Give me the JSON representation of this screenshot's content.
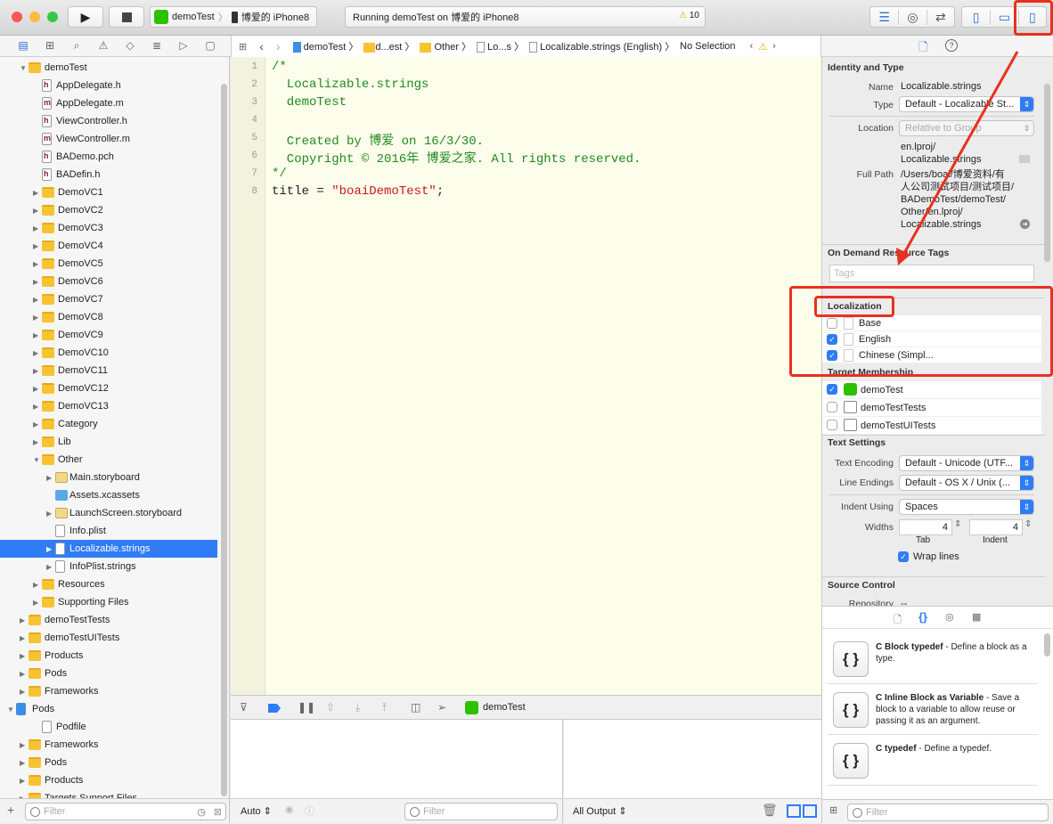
{
  "toolbar": {
    "scheme": "demoTest",
    "device": "博爱的 iPhone8",
    "status": "Running demoTest on 博爱的 iPhone8",
    "warnings": "10"
  },
  "jumpbar": [
    "demoTest",
    "d...est",
    "Other",
    "Lo...s",
    "Localizable.strings (English)",
    "No Selection"
  ],
  "navigator": {
    "items": [
      {
        "label": "demoTest",
        "level": 1,
        "type": "folder",
        "open": true
      },
      {
        "label": "AppDelegate.h",
        "level": 2,
        "type": "h"
      },
      {
        "label": "AppDelegate.m",
        "level": 2,
        "type": "m"
      },
      {
        "label": "ViewController.h",
        "level": 2,
        "type": "h"
      },
      {
        "label": "ViewController.m",
        "level": 2,
        "type": "m"
      },
      {
        "label": "BADemo.pch",
        "level": 2,
        "type": "h"
      },
      {
        "label": "BADefin.h",
        "level": 2,
        "type": "h"
      },
      {
        "label": "DemoVC1",
        "level": 2,
        "type": "folder",
        "closed": true
      },
      {
        "label": "DemoVC2",
        "level": 2,
        "type": "folder",
        "closed": true
      },
      {
        "label": "DemoVC3",
        "level": 2,
        "type": "folder",
        "closed": true
      },
      {
        "label": "DemoVC4",
        "level": 2,
        "type": "folder",
        "closed": true
      },
      {
        "label": "DemoVC5",
        "level": 2,
        "type": "folder",
        "closed": true
      },
      {
        "label": "DemoVC6",
        "level": 2,
        "type": "folder",
        "closed": true
      },
      {
        "label": "DemoVC7",
        "level": 2,
        "type": "folder",
        "closed": true
      },
      {
        "label": "DemoVC8",
        "level": 2,
        "type": "folder",
        "closed": true
      },
      {
        "label": "DemoVC9",
        "level": 2,
        "type": "folder",
        "closed": true
      },
      {
        "label": "DemoVC10",
        "level": 2,
        "type": "folder",
        "closed": true
      },
      {
        "label": "DemoVC11",
        "level": 2,
        "type": "folder",
        "closed": true
      },
      {
        "label": "DemoVC12",
        "level": 2,
        "type": "folder",
        "closed": true
      },
      {
        "label": "DemoVC13",
        "level": 2,
        "type": "folder",
        "closed": true
      },
      {
        "label": "Category",
        "level": 2,
        "type": "folder",
        "closed": true
      },
      {
        "label": "Lib",
        "level": 2,
        "type": "folder",
        "closed": true
      },
      {
        "label": "Other",
        "level": 2,
        "type": "folder",
        "open": true
      },
      {
        "label": "Main.storyboard",
        "level": 3,
        "type": "storyboard",
        "closed": true
      },
      {
        "label": "Assets.xcassets",
        "level": 3,
        "type": "xcassets"
      },
      {
        "label": "LaunchScreen.storyboard",
        "level": 3,
        "type": "storyboard",
        "closed": true
      },
      {
        "label": "Info.plist",
        "level": 3,
        "type": "file"
      },
      {
        "label": "Localizable.strings",
        "level": 3,
        "type": "file",
        "closed": true,
        "selected": true
      },
      {
        "label": "InfoPlist.strings",
        "level": 3,
        "type": "file",
        "closed": true
      },
      {
        "label": "Resources",
        "level": 2,
        "type": "folder",
        "closed": true
      },
      {
        "label": "Supporting Files",
        "level": 2,
        "type": "folder",
        "closed": true
      },
      {
        "label": "demoTestTests",
        "level": 1,
        "type": "folder",
        "closed": true
      },
      {
        "label": "demoTestUITests",
        "level": 1,
        "type": "folder",
        "closed": true
      },
      {
        "label": "Products",
        "level": 1,
        "type": "folder",
        "closed": true
      },
      {
        "label": "Pods",
        "level": 1,
        "type": "folder",
        "closed": true
      },
      {
        "label": "Frameworks",
        "level": 1,
        "type": "folder",
        "closed": true
      },
      {
        "label": "Pods",
        "level": 0,
        "type": "proj",
        "open": true
      },
      {
        "label": "Podfile",
        "level": 2,
        "type": "file"
      },
      {
        "label": "Frameworks",
        "level": 1,
        "type": "folder",
        "closed": true
      },
      {
        "label": "Pods",
        "level": 1,
        "type": "folder",
        "closed": true
      },
      {
        "label": "Products",
        "level": 1,
        "type": "folder",
        "closed": true
      },
      {
        "label": "Targets Support Files",
        "level": 1,
        "type": "folder",
        "closed": true
      }
    ],
    "filter_placeholder": "Filter"
  },
  "editor": {
    "lines": [
      [
        {
          "t": "/*",
          "c": "cm"
        }
      ],
      [
        {
          "t": "  Localizable.strings",
          "c": "cm"
        }
      ],
      [
        {
          "t": "  demoTest",
          "c": "cm"
        }
      ],
      [],
      [
        {
          "t": "  Created by 博爱 on 16/3/30.",
          "c": "cm"
        }
      ],
      [
        {
          "t": "  Copyright © 2016年 博爱之家. All rights reserved.",
          "c": "cm"
        }
      ],
      [
        {
          "t": "*/",
          "c": "cm"
        }
      ],
      [
        {
          "t": "title = ",
          "c": ""
        },
        {
          "t": "\"boaiDemoTest\"",
          "c": "str"
        },
        {
          "t": ";",
          "c": ""
        }
      ]
    ]
  },
  "debug": {
    "target": "demoTest",
    "auto": "Auto ⇕",
    "all_output": "All Output ⇕",
    "filter_placeholder": "Filter"
  },
  "inspector": {
    "identity_title": "Identity and Type",
    "name_label": "Name",
    "name": "Localizable.strings",
    "type_label": "Type",
    "type": "Default - Localizable St...",
    "location_label": "Location",
    "location": "Relative to Group",
    "location_path": "en.lproj/\nLocalizable.strings",
    "fullpath_label": "Full Path",
    "fullpath": "/Users/boai/博爱资料/有\n人公司测试项目/测试项目/\nBADemoTest/demoTest/\nOther/en.lproj/\nLocalizable.strings",
    "odr_title": "On Demand Resource Tags",
    "tags_placeholder": "Tags",
    "loc_title": "Localization",
    "localizations": [
      {
        "label": "Base",
        "checked": false
      },
      {
        "label": "English",
        "checked": true
      },
      {
        "label": "Chinese (Simpl...",
        "checked": true
      }
    ],
    "target_title": "Target Membership",
    "targets": [
      {
        "label": "demoTest",
        "checked": true
      },
      {
        "label": "demoTestTests",
        "checked": false
      },
      {
        "label": "demoTestUITests",
        "checked": false
      }
    ],
    "text_title": "Text Settings",
    "encoding_label": "Text Encoding",
    "encoding": "Default - Unicode (UTF...",
    "endings_label": "Line Endings",
    "endings": "Default - OS X / Unix (...",
    "indent_label": "Indent Using",
    "indent": "Spaces",
    "widths_label": "Widths",
    "tab_width": "4",
    "indent_width": "4",
    "tab_label": "Tab",
    "indent_sub": "Indent",
    "wrap_label": "Wrap lines",
    "wrap": true,
    "sc_title": "Source Control",
    "repo_label": "Repository",
    "repo": "--"
  },
  "library": {
    "snippets": [
      {
        "title": "C Block typedef",
        "desc": " - Define a block as a type."
      },
      {
        "title": "C Inline Block as Variable",
        "desc": " - Save a block to a variable to allow reuse or passing it as an argument."
      },
      {
        "title": "C typedef",
        "desc": " - Define a typedef."
      }
    ],
    "filter_placeholder": "Filter"
  },
  "colors": {
    "accent": "#2f7cf6",
    "annotation": "#e8311e",
    "comment": "#1f8a1f",
    "string": "#c41a16"
  }
}
